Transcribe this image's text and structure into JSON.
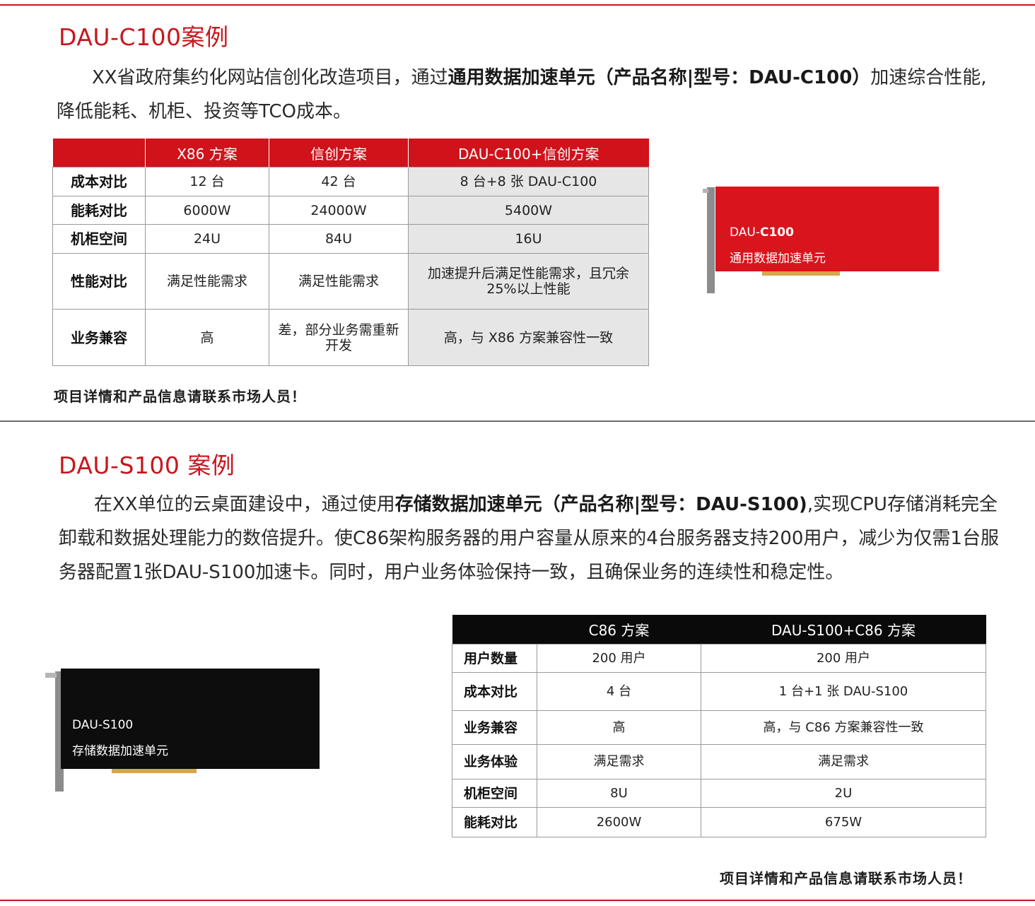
{
  "case1": {
    "title": "DAU-C100案例",
    "para": {
      "lead": "XX省政府集约化网站信创化改造项目，通过",
      "bold": "通用数据加速单元（产品名称|型号：DAU-C100）",
      "tail": "加速综合性能,降低能耗、机柜、投资等TCO成本。"
    },
    "table": {
      "headers": [
        "",
        "X86 方案",
        "信创方案",
        "DAU-C100+信创方案"
      ],
      "rows": [
        [
          "成本对比",
          "12 台",
          "42 台",
          "8 台+8 张 DAU-C100"
        ],
        [
          "能耗对比",
          "6000W",
          "24000W",
          "5400W"
        ],
        [
          "机柜空间",
          "24U",
          "84U",
          "16U"
        ],
        [
          "性能对比",
          "满足性能需求",
          "满足性能需求",
          "加速提升后满足性能需求，且冗余 25%以上性能"
        ],
        [
          "业务兼容",
          "高",
          "差，部分业务需重新开发",
          "高，与 X86 方案兼容性一致"
        ]
      ]
    },
    "note": "项目详情和产品信息请联系市场人员！",
    "card": {
      "model_prefix": "DAU-",
      "model_bold": "C100",
      "desc": "通用数据加速单元",
      "color": "#d9141c"
    }
  },
  "case2": {
    "title": "DAU-S100 案例",
    "para": {
      "lead": "在XX单位的云桌面建设中，通过使用",
      "bold": "存储数据加速单元（产品名称|型号：DAU-S100)",
      "tail": ",实现CPU存储消耗完全卸载和数据处理能力的数倍提升。使C86架构服务器的用户容量从原来的4台服务器支持200用户，减少为仅需1台服务器配置1张DAU-S100加速卡。同时，用户业务体验保持一致，且确保业务的连续性和稳定性。"
    },
    "table": {
      "headers": [
        "",
        "C86 方案",
        "DAU-S100+C86 方案"
      ],
      "rows": [
        [
          "用户数量",
          "200 用户",
          "200 用户"
        ],
        [
          "成本对比",
          "4 台",
          "1 台+1 张 DAU-S100"
        ],
        [
          "业务兼容",
          "高",
          "高，与 C86 方案兼容性一致"
        ],
        [
          "业务体验",
          "满足需求",
          "满足需求"
        ],
        [
          "机柜空间",
          "8U",
          "2U"
        ],
        [
          "能耗对比",
          "2600W",
          "675W"
        ]
      ]
    },
    "note": "项目详情和产品信息请联系市场人员！",
    "card": {
      "model": "DAU-S100",
      "desc": "存储数据加速单元",
      "color": "#0d0d0d"
    }
  },
  "colors": {
    "accent": "#c8161d",
    "divider": "#6e6e6e"
  }
}
